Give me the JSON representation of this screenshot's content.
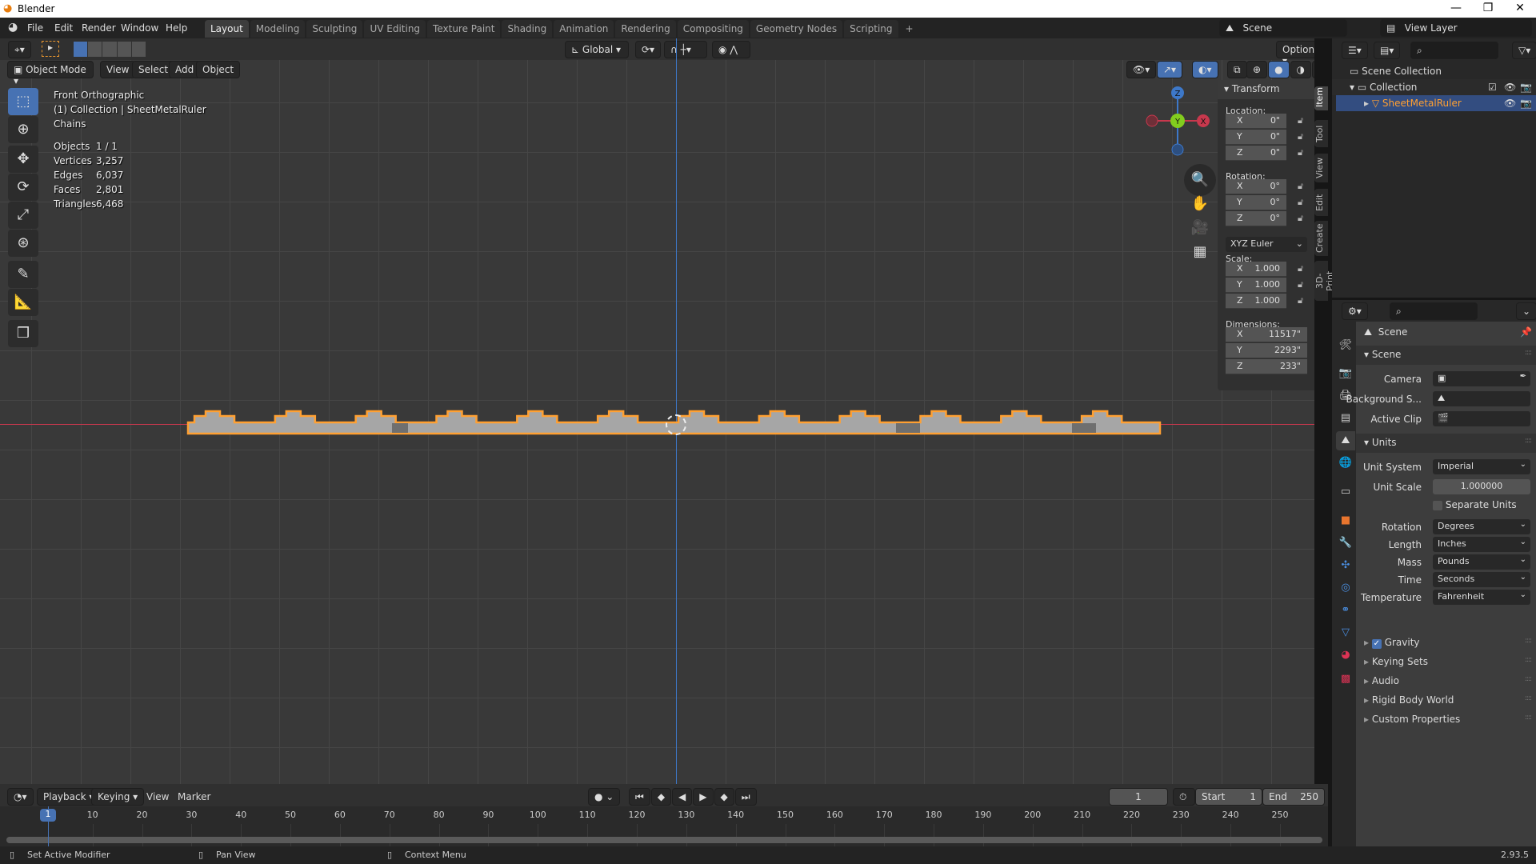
{
  "window": {
    "title": "Blender",
    "controls": [
      "—",
      "❐",
      "✕"
    ]
  },
  "menu": [
    "File",
    "Edit",
    "Render",
    "Window",
    "Help"
  ],
  "workspaces": [
    {
      "label": "Layout",
      "active": true
    },
    {
      "label": "Modeling"
    },
    {
      "label": "Sculpting"
    },
    {
      "label": "UV Editing"
    },
    {
      "label": "Texture Paint"
    },
    {
      "label": "Shading"
    },
    {
      "label": "Animation"
    },
    {
      "label": "Rendering"
    },
    {
      "label": "Compositing"
    },
    {
      "label": "Geometry Nodes"
    },
    {
      "label": "Scripting"
    }
  ],
  "add_workspace": "+",
  "scene": {
    "label": "Scene",
    "view_layer": "View Layer"
  },
  "tool_header": {
    "orientation": "Global",
    "options": "Options"
  },
  "viewport_header": {
    "mode": "Object Mode",
    "menus": [
      "View",
      "Select",
      "Add",
      "Object"
    ]
  },
  "overlay": {
    "view": "Front Orthographic",
    "collection": "(1) Collection | SheetMetalRuler",
    "extra": "Chains",
    "stats": [
      {
        "label": "Objects",
        "value": "1 / 1"
      },
      {
        "label": "Vertices",
        "value": "3,257"
      },
      {
        "label": "Edges",
        "value": "6,037"
      },
      {
        "label": "Faces",
        "value": "2,801"
      },
      {
        "label": "Triangles",
        "value": "6,468"
      }
    ]
  },
  "gizmo": {
    "z": "Z",
    "y": "Y",
    "x": "X"
  },
  "npanel": {
    "title": "Transform",
    "location_label": "Location:",
    "location": [
      {
        "axis": "X",
        "value": "0\""
      },
      {
        "axis": "Y",
        "value": "0\""
      },
      {
        "axis": "Z",
        "value": "0\""
      }
    ],
    "rotation_label": "Rotation:",
    "rotation": [
      {
        "axis": "X",
        "value": "0°"
      },
      {
        "axis": "Y",
        "value": "0°"
      },
      {
        "axis": "Z",
        "value": "0°"
      }
    ],
    "rotation_mode": "XYZ Euler",
    "scale_label": "Scale:",
    "scale": [
      {
        "axis": "X",
        "value": "1.000"
      },
      {
        "axis": "Y",
        "value": "1.000"
      },
      {
        "axis": "Z",
        "value": "1.000"
      }
    ],
    "dimensions_label": "Dimensions:",
    "dimensions": [
      {
        "axis": "X",
        "value": "11517\""
      },
      {
        "axis": "Y",
        "value": "2293\""
      },
      {
        "axis": "Z",
        "value": "233\""
      }
    ],
    "tabs": [
      {
        "label": "Item",
        "active": true
      },
      {
        "label": "Tool"
      },
      {
        "label": "View"
      },
      {
        "label": "Edit"
      },
      {
        "label": "Create"
      },
      {
        "label": "3D-Print"
      }
    ]
  },
  "outliner": {
    "items": [
      {
        "label": "Scene Collection"
      },
      {
        "label": "Collection"
      },
      {
        "label": "SheetMetalRuler",
        "selected": true
      }
    ]
  },
  "properties": {
    "context": "Scene",
    "scene_section": "Scene",
    "camera_label": "Camera",
    "background_label": "Background S...",
    "clip_label": "Active Clip",
    "units_section": "Units",
    "units": [
      {
        "label": "Unit System",
        "value": "Imperial"
      },
      {
        "label": "Unit Scale",
        "value": "1.000000"
      }
    ],
    "separate_units": "Separate Units",
    "separate_units_checked": false,
    "units2": [
      {
        "label": "Rotation",
        "value": "Degrees"
      },
      {
        "label": "Length",
        "value": "Inches"
      },
      {
        "label": "Mass",
        "value": "Pounds"
      },
      {
        "label": "Time",
        "value": "Seconds"
      },
      {
        "label": "Temperature",
        "value": "Fahrenheit"
      }
    ],
    "gravity": "Gravity",
    "gravity_checked": true,
    "collapsed": [
      "Keying Sets",
      "Audio",
      "Rigid Body World",
      "Custom Properties"
    ]
  },
  "timeline": {
    "menus": [
      "Playback",
      "Keying",
      "View",
      "Marker"
    ],
    "current_frame": "1",
    "start_label": "Start",
    "start": "1",
    "end_label": "End",
    "end": "250",
    "ticks": [
      "10",
      "20",
      "30",
      "40",
      "50",
      "60",
      "70",
      "80",
      "90",
      "100",
      "110",
      "120",
      "130",
      "140",
      "150",
      "160",
      "170",
      "180",
      "190",
      "200",
      "210",
      "220",
      "230",
      "240",
      "250"
    ]
  },
  "statusbar": {
    "left": "Set Active Modifier",
    "middle": "Pan View",
    "right": "Context Menu",
    "version": "2.93.5"
  },
  "colors": {
    "accent": "#4772b3",
    "selection": "#ffa032",
    "x_axis": "#c8384d",
    "y_axis": "#82cc1e",
    "z_axis": "#3d78c9"
  }
}
